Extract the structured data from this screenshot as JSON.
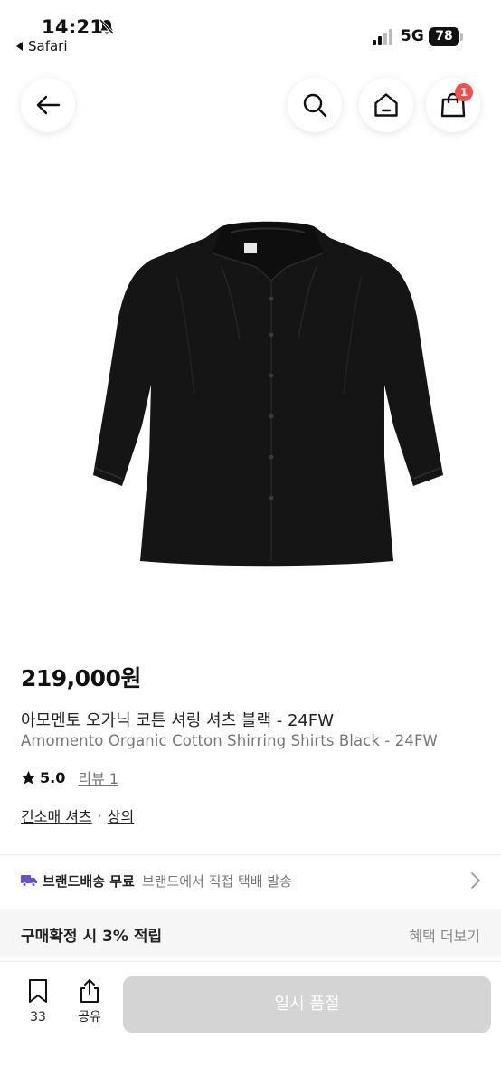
{
  "status_bar": {
    "time": "14:21",
    "back_app": "Safari",
    "network": "5G",
    "battery": "78"
  },
  "header": {
    "cart_count": "1",
    "icons": [
      "back-arrow-icon",
      "search-icon",
      "home-icon",
      "shopping-bag-icon"
    ]
  },
  "product": {
    "image_alt": "black shirt product photo",
    "price": "219,000원",
    "title_ko": "아모멘토 오가닉 코튼 셔링 셔츠 블랙 - 24FW",
    "title_en": "Amomento Organic Cotton Shirring Shirts Black - 24FW",
    "rating": "5.0",
    "review_link": "리뷰 1",
    "category": "긴소매 셔츠",
    "category_sep": "·",
    "parent_category": "상의"
  },
  "shipping": {
    "label": "브랜드배송 무료",
    "detail": "브랜드에서 직접 택배 발송"
  },
  "benefit": {
    "label": "구매확정 시 3% 적립",
    "more": "혜택 더보기"
  },
  "bottom": {
    "save_count": "33",
    "share_label": "공유",
    "buy_button": "일시 품절"
  },
  "colors": {
    "badge": "#f4504b",
    "disabled_button": "#d4d4d4",
    "truck_icon": "#6b4bd8"
  }
}
